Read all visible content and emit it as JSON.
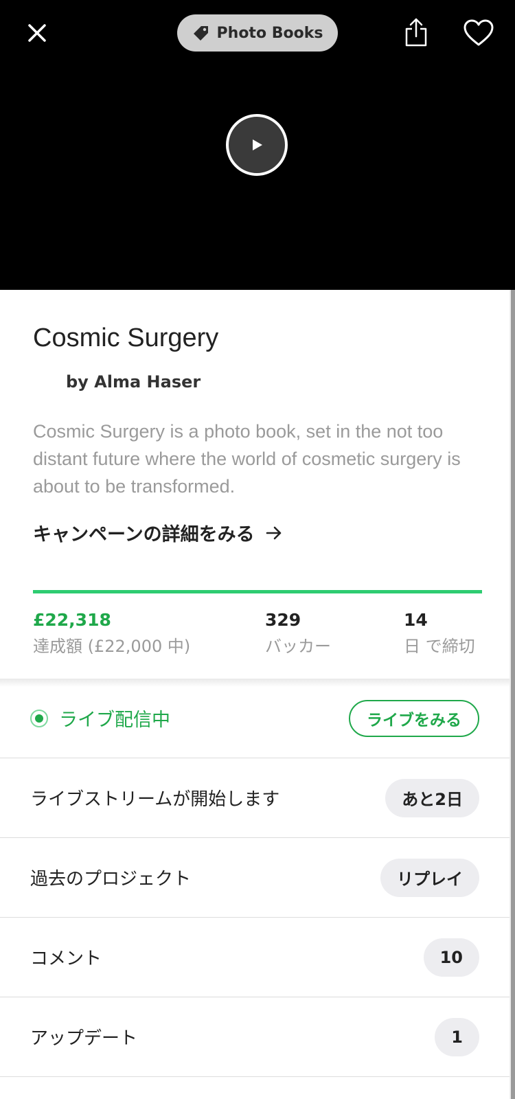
{
  "header": {
    "category_label": "Photo Books",
    "icons": {
      "close": "close-icon",
      "tag": "tag-icon",
      "share": "share-icon",
      "like": "heart-icon",
      "play": "play-icon"
    }
  },
  "project": {
    "title": "Cosmic Surgery",
    "creator": "by Alma Haser",
    "description": "Cosmic Surgery is a photo book, set in the not too distant future where the world of cosmetic surgery is about to be transformed.",
    "details_link": "キャンペーンの詳細をみる",
    "progress_fraction": 1.0,
    "stats": {
      "pledged_amount": "£22,318",
      "pledged_label": "達成額 (£22,000 中)",
      "backers_count": "329",
      "backers_label": "バッカー",
      "days_count": "14",
      "days_label": "日 で締切"
    }
  },
  "rows": {
    "live": {
      "label": "ライブ配信中",
      "button": "ライブをみる"
    },
    "upcoming": {
      "label": "ライブストリームが開始します",
      "pill": "あと2日"
    },
    "past": {
      "label": "過去のプロジェクト",
      "pill": "リプレイ"
    },
    "comments": {
      "label": "コメント",
      "pill": "10"
    },
    "updates": {
      "label": "アップデート",
      "pill": "1"
    }
  },
  "colors": {
    "accent_green": "#1fa84a",
    "progress_green": "#2ecc71"
  }
}
